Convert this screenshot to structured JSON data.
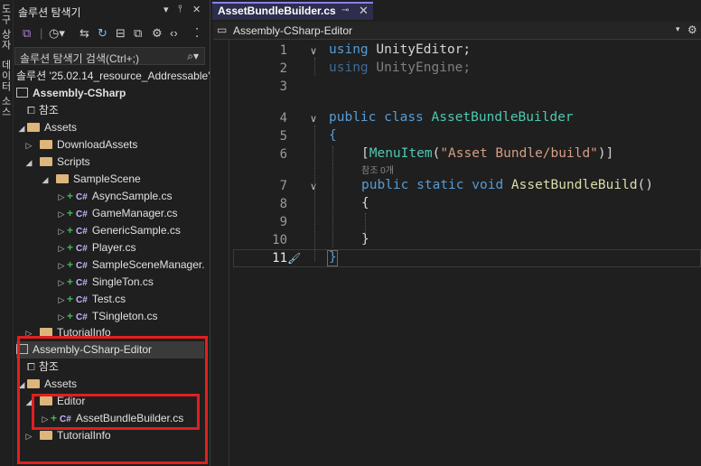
{
  "left_strip": {
    "tabs": [
      "도구 상자",
      "데이터 소스"
    ]
  },
  "solution_explorer": {
    "title": "솔루션 탐색기",
    "title_buttons": {
      "dropdown": "▾",
      "pin": "🖈",
      "close": "✕"
    },
    "search": {
      "placeholder": "솔루션 탐색기 검색(Ctrl+;)",
      "icon": "search-icon"
    },
    "solution_label": "솔루션 '25.02.14_resource_Addressable'",
    "tree": [
      {
        "label": "Assembly-CSharp",
        "kind": "project"
      },
      {
        "label": "참조",
        "kind": "references"
      },
      {
        "label": "Assets",
        "kind": "folder-open"
      },
      {
        "label": "DownloadAssets",
        "kind": "folder"
      },
      {
        "label": "Scripts",
        "kind": "folder-open"
      },
      {
        "label": "SampleScene",
        "kind": "folder-open"
      },
      {
        "label": "AsyncSample.cs",
        "kind": "cs"
      },
      {
        "label": "GameManager.cs",
        "kind": "cs"
      },
      {
        "label": "GenericSample.cs",
        "kind": "cs"
      },
      {
        "label": "Player.cs",
        "kind": "cs"
      },
      {
        "label": "SampleSceneManager.",
        "kind": "cs"
      },
      {
        "label": "SingleTon.cs",
        "kind": "cs"
      },
      {
        "label": "Test.cs",
        "kind": "cs"
      },
      {
        "label": "TSingleton.cs",
        "kind": "cs"
      },
      {
        "label": "TutorialInfo",
        "kind": "folder"
      },
      {
        "label": "Assembly-CSharp-Editor",
        "kind": "project"
      },
      {
        "label": "참조",
        "kind": "references"
      },
      {
        "label": "Assets",
        "kind": "folder-open"
      },
      {
        "label": "Editor",
        "kind": "folder-open"
      },
      {
        "label": "AssetBundleBuilder.cs",
        "kind": "cs"
      },
      {
        "label": "TutorialInfo",
        "kind": "folder"
      }
    ],
    "cs_badge": "C#",
    "plus_badge": "+"
  },
  "editor": {
    "tab": {
      "label": "AssetBundleBuilder.cs",
      "pin": "⊸",
      "close": "✕"
    },
    "nav": {
      "project": "Assembly-CSharp-Editor",
      "dropdown": "▾"
    },
    "codelens": "참조 0개",
    "line_numbers": [
      "1",
      "2",
      "3",
      "4",
      "5",
      "6",
      "7",
      "8",
      "9",
      "10",
      "11"
    ],
    "code": {
      "l1_kw": "using",
      "l1_rest": " UnityEditor;",
      "l2_kw": "using",
      "l2_rest": " UnityEngine;",
      "l4_kw1": "public",
      "l4_kw2": "class",
      "l4_type": "AssetBundleBuilder",
      "l5": "{",
      "l6_open": "[",
      "l6_type": "MenuItem",
      "l6_paren": "(",
      "l6_str": "\"Asset Bundle/build\"",
      "l6_close": ")]",
      "l7_kw1": "public",
      "l7_kw2": "static",
      "l7_kw3": "void",
      "l7_fn": "AssetBundleBuild",
      "l7_paren": "()",
      "l8": "{",
      "l10": "}",
      "l11": "}"
    }
  },
  "colors": {
    "highlight_box": "#e0201f",
    "tab_accent": "#8a7ff0"
  }
}
